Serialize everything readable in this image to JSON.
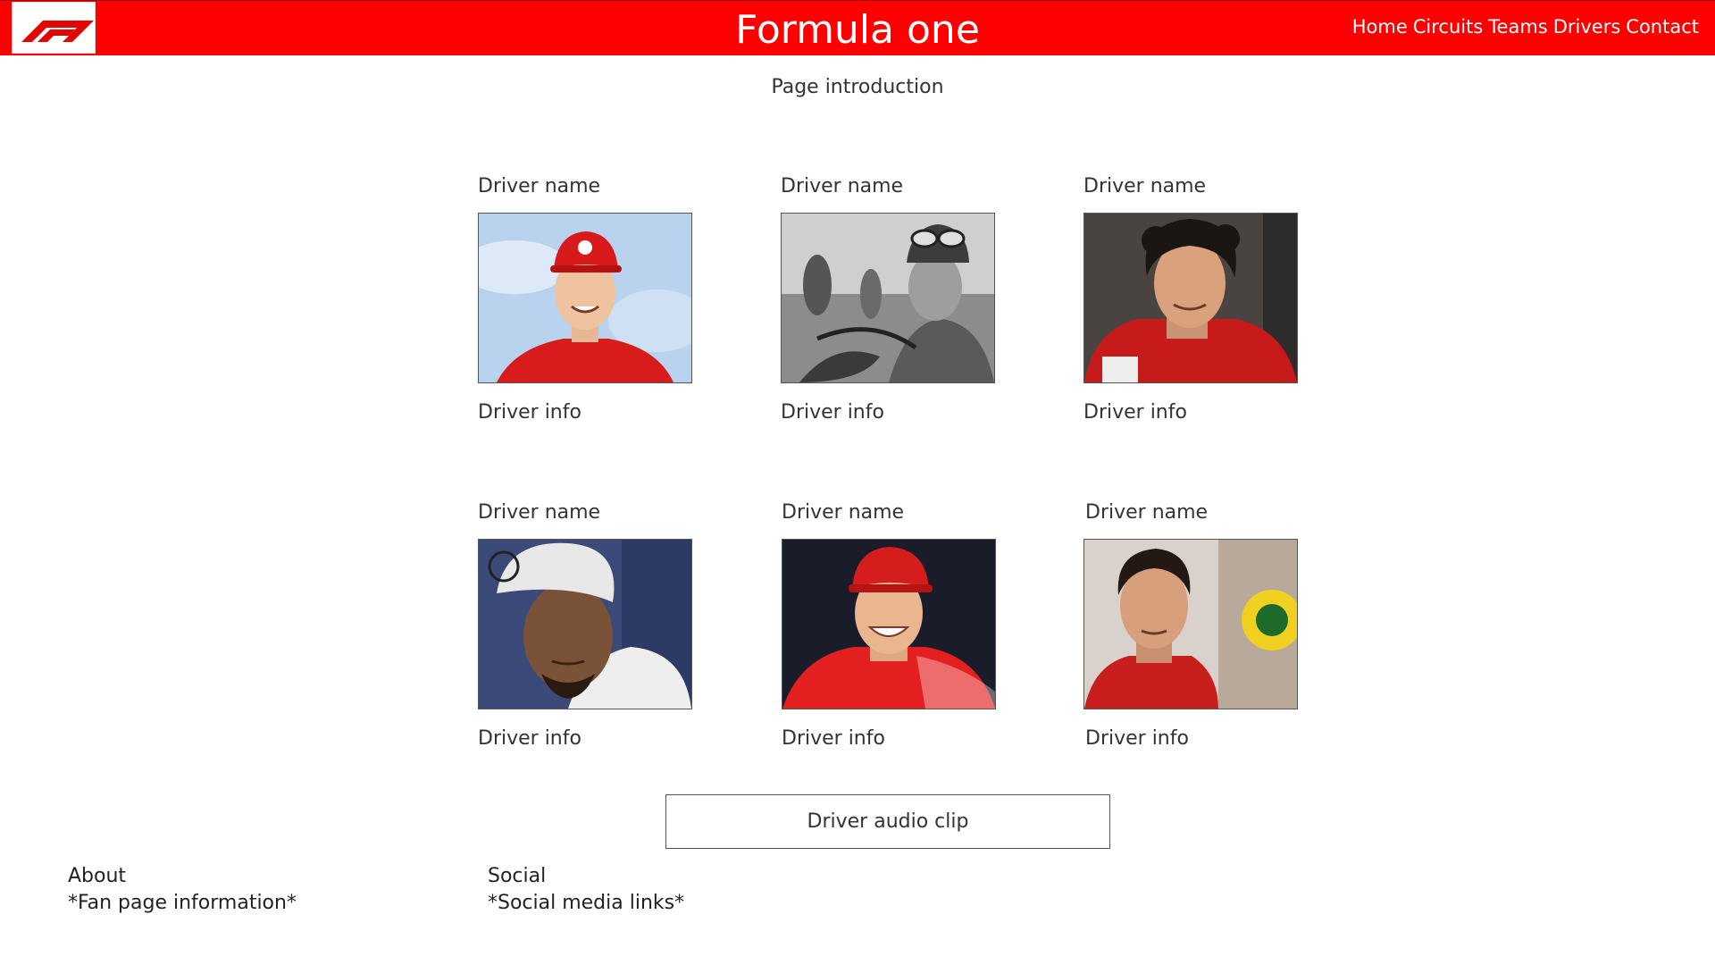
{
  "header": {
    "logo_icon": "f1-logo-icon",
    "title": "Formula one",
    "nav": [
      "Home",
      "Circuits",
      "Teams",
      "Drivers",
      "Contact"
    ],
    "colors": {
      "bar": "#ff0000",
      "text": "#ffffff"
    }
  },
  "intro": "Page introduction",
  "drivers": [
    {
      "name": "Driver name",
      "info": "Driver info",
      "photo": "driver-photo-red-cap"
    },
    {
      "name": "Driver name",
      "info": "Driver info",
      "photo": "driver-photo-black-white-goggles"
    },
    {
      "name": "Driver name",
      "info": "Driver info",
      "photo": "driver-photo-curly-hair-red-suit"
    },
    {
      "name": "Driver name",
      "info": "Driver info",
      "photo": "driver-photo-white-cap"
    },
    {
      "name": "Driver name",
      "info": "Driver info",
      "photo": "driver-photo-red-cap-smiling"
    },
    {
      "name": "Driver name",
      "info": "Driver info",
      "photo": "driver-photo-dark-hair-red-suit"
    }
  ],
  "audio_button": "Driver audio clip",
  "footer": {
    "about": {
      "title": "About",
      "text": "*Fan page information*"
    },
    "social": {
      "title": "Social",
      "text": "*Social media links*"
    }
  }
}
